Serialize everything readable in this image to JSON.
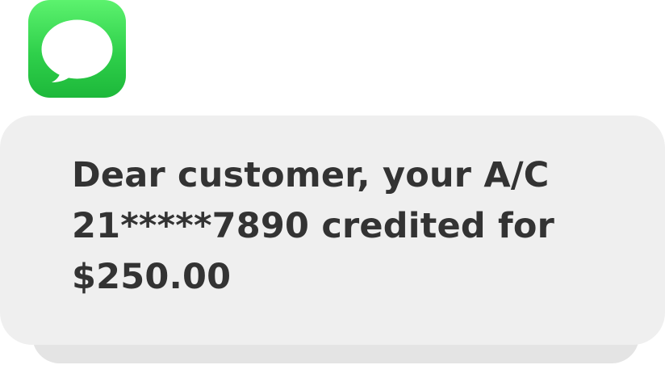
{
  "app": {
    "icon": "messages-app-icon",
    "icon_color": "#34d058"
  },
  "notification": {
    "message": "Dear customer, your A/C\n21*****7890 credited for\n$250.00",
    "bubble_color": "#efefef",
    "text_color": "#333333"
  }
}
